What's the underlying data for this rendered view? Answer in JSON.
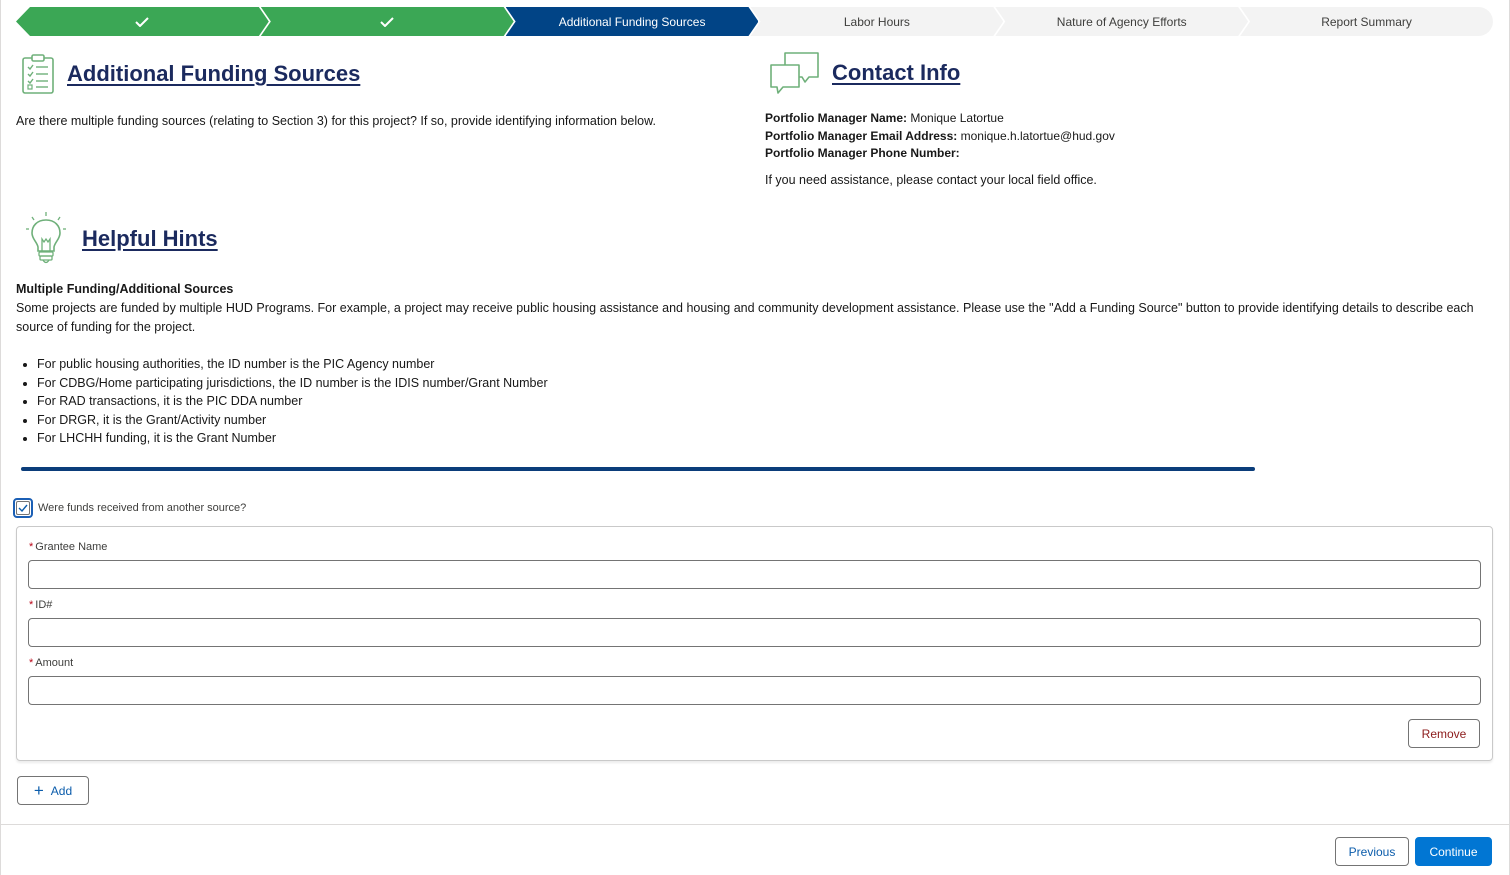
{
  "progress": {
    "steps": [
      {
        "label": "",
        "state": "done",
        "icon": "check-icon"
      },
      {
        "label": "",
        "state": "done",
        "icon": "check-icon"
      },
      {
        "label": "Additional Funding Sources",
        "state": "current"
      },
      {
        "label": "Labor Hours",
        "state": "todo"
      },
      {
        "label": "Nature of Agency Efforts",
        "state": "todo"
      },
      {
        "label": "Report Summary",
        "state": "todo"
      }
    ]
  },
  "funding": {
    "title": "Additional Funding Sources",
    "icon": "clipboard-checklist-icon",
    "question": "Are there multiple funding sources (relating to Section 3) for this project? If so, provide identifying information below."
  },
  "contact": {
    "title": "Contact Info",
    "icon": "chat-bubbles-icon",
    "name_label": "Portfolio Manager Name:",
    "name_value": "Monique Latortue",
    "email_label": "Portfolio Manager Email Address:",
    "email_value": "monique.h.latortue@hud.gov",
    "phone_label": "Portfolio Manager Phone Number:",
    "phone_value": "",
    "assist": "If you need assistance, please contact your local field office."
  },
  "hints": {
    "title": "Helpful Hints",
    "icon": "lightbulb-icon",
    "subtitle": "Multiple Funding/Additional Sources",
    "body": "Some projects are funded by multiple HUD Programs. For example, a project may receive public housing assistance and housing and community development assistance. Please use the \"Add a Funding Source\" button to provide identifying details to describe each source of funding for the project.",
    "items": [
      "For public housing authorities, the ID number is the PIC Agency number",
      "For CDBG/Home participating jurisdictions, the ID number is the IDIS number/Grant Number",
      "For RAD transactions, it is the PIC DDA number",
      "For DRGR, it is the Grant/Activity number",
      "For LHCHH funding, it is the Grant Number"
    ]
  },
  "form": {
    "checkbox_label": "Were funds received from another source?",
    "checkbox_checked": true,
    "required_mark": "*",
    "grantee_label": "Grantee Name",
    "grantee_value": "",
    "id_label": "ID#",
    "id_value": "",
    "amount_label": "Amount",
    "amount_value": "",
    "remove_label": "Remove",
    "add_label": "Add"
  },
  "footer": {
    "previous_label": "Previous",
    "continue_label": "Continue"
  },
  "colors": {
    "done": "#3ba755",
    "current": "#014486",
    "todo": "#f3f3f3",
    "primary_button": "#0176d3",
    "heading": "#1b2a5e",
    "icon_green": "#5aa86a"
  }
}
